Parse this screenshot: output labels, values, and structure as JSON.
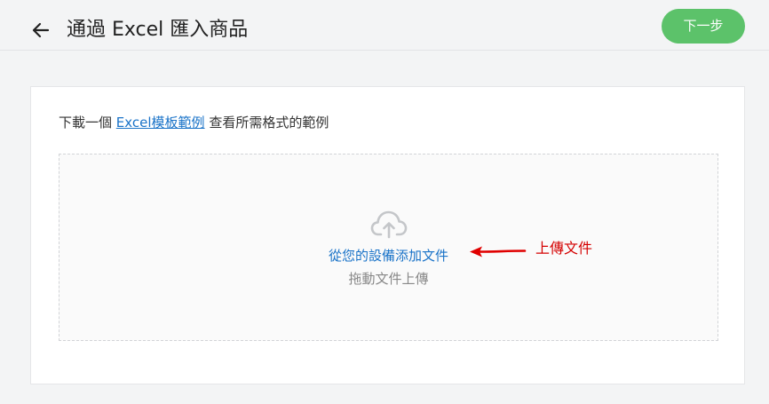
{
  "header": {
    "back_icon": "arrow-left-icon",
    "title": "通過 Excel 匯入商品",
    "next_label": "下一步",
    "next_color": "#5cc26a"
  },
  "instruction": {
    "prefix": "下載一個",
    "link": "Excel模板範例",
    "suffix": "查看所需格式的範例"
  },
  "dropzone": {
    "icon": "cloud-upload-icon",
    "upload_link": "從您的設備添加文件",
    "drag_hint": "拖動文件上傳"
  },
  "annotation": {
    "text": "上傳文件",
    "color": "#d40000"
  }
}
